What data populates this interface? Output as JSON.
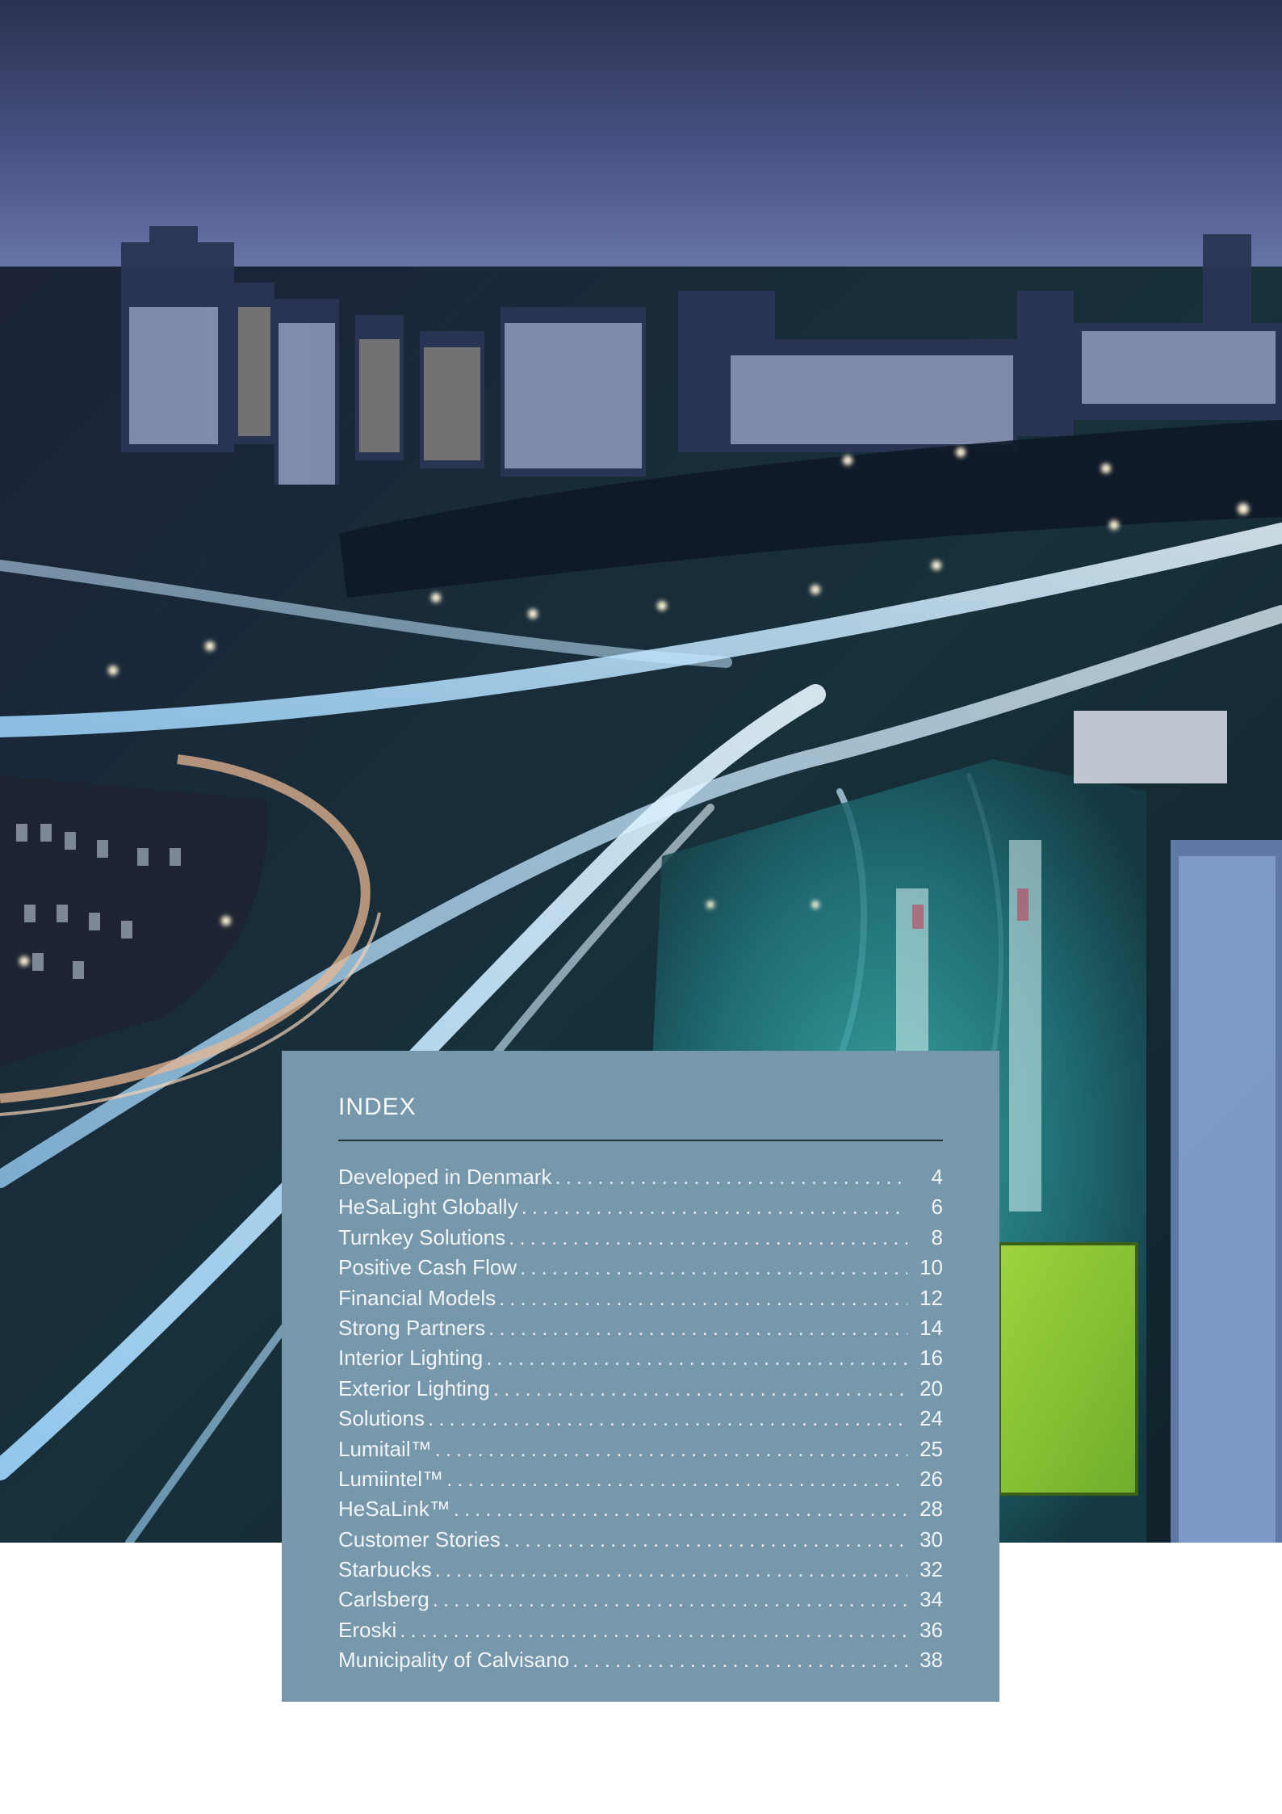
{
  "index": {
    "title": "INDEX",
    "leader": "........................................................................................................................................",
    "entries": [
      {
        "label": "Developed in Denmark",
        "page": "4"
      },
      {
        "label": "HeSaLight Globally",
        "page": "6"
      },
      {
        "label": "Turnkey Solutions",
        "page": "8"
      },
      {
        "label": "Positive Cash Flow",
        "page": "10"
      },
      {
        "label": "Financial Models",
        "page": "12"
      },
      {
        "label": "Strong Partners",
        "page": "14"
      },
      {
        "label": "Interior Lighting",
        "page": "16"
      },
      {
        "label": "Exterior Lighting",
        "page": "20"
      },
      {
        "label": "Solutions",
        "page": "24"
      },
      {
        "label": "Lumitail™",
        "page": "25"
      },
      {
        "label": "Lumiintel™",
        "page": "26"
      },
      {
        "label": "HeSaLink™",
        "page": "28"
      },
      {
        "label": "Customer Stories",
        "page": "30"
      },
      {
        "label": "Starbucks",
        "page": "32"
      },
      {
        "label": "Carlsberg",
        "page": "34"
      },
      {
        "label": "Eroski",
        "page": "36"
      },
      {
        "label": "Municipality of Calvisano",
        "page": "38"
      }
    ]
  },
  "colors": {
    "panel": "#7797ab",
    "rule": "#27333b",
    "text": "#f1f5f8"
  }
}
